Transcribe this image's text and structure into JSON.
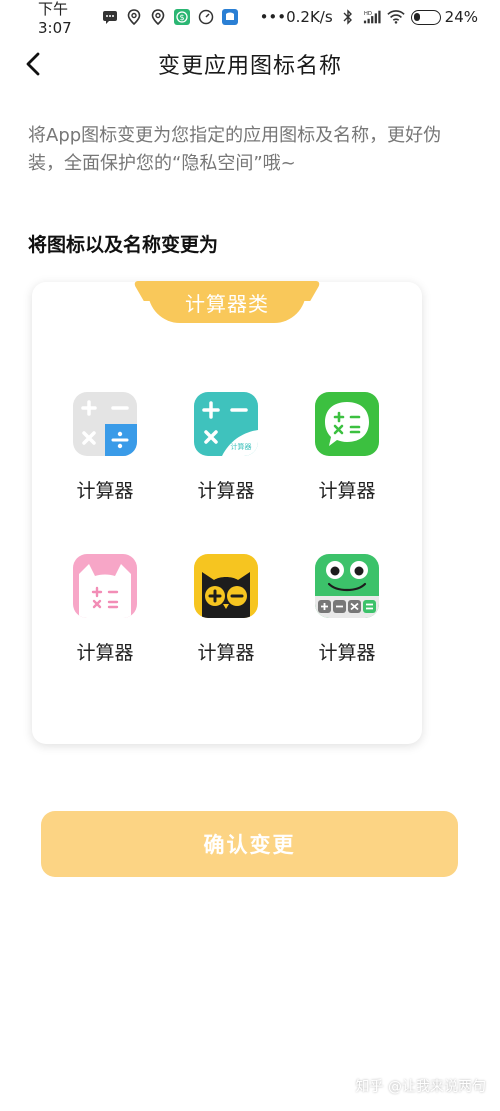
{
  "status_bar": {
    "time": "下午3:07",
    "network_speed": "0.2K/s",
    "battery_percent": "24%",
    "battery_level": 0.24,
    "left_icons": [
      "message-icon",
      "location-pin-icon",
      "location-pin-icon",
      "dollar-app-icon",
      "speedometer-icon",
      "app-shield-icon"
    ],
    "right_icons": [
      "bluetooth-icon",
      "hd-signal-icon",
      "wifi-icon",
      "battery-icon"
    ],
    "more": "•••"
  },
  "header": {
    "title": "变更应用图标名称",
    "back_icon": "chevron-left-icon"
  },
  "description": "将App图标变更为您指定的应用图标及名称，更好伪装，全面保护您的“隐私空间”哦~",
  "section_title": "将图标以及名称变更为",
  "card": {
    "tag": "计算器类",
    "icons": [
      {
        "label": "计算器",
        "icon": "calculator-grey-blue-icon"
      },
      {
        "label": "计算器",
        "icon": "calculator-teal-icon",
        "badge": "计算器"
      },
      {
        "label": "计算器",
        "icon": "calculator-green-bubble-icon"
      },
      {
        "label": "计算器",
        "icon": "calculator-pink-cat-icon"
      },
      {
        "label": "计算器",
        "icon": "calculator-owl-icon"
      },
      {
        "label": "计算器",
        "icon": "calculator-frog-icon"
      }
    ]
  },
  "confirm_button": "确认变更",
  "watermark": "知乎 @让我来说两句",
  "colors": {
    "accent": "#f9c85a",
    "button": "#fcd484",
    "teal": "#3fc2bd",
    "green": "#3cc040",
    "yellow": "#f6c520",
    "pink": "#f7a6c7",
    "blue": "#3a9be8"
  }
}
